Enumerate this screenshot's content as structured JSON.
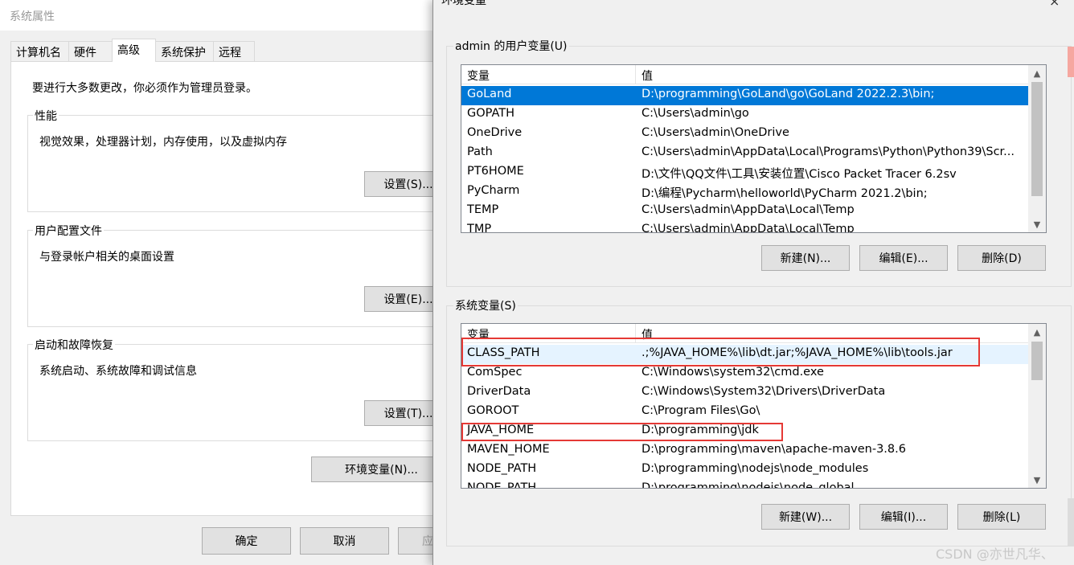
{
  "system_properties": {
    "title": "系统属性",
    "tabs": [
      "计算机名",
      "硬件",
      "高级",
      "系统保护",
      "远程"
    ],
    "active_tab": "高级",
    "admin_note": "要进行大多数更改，你必须作为管理员登录。",
    "performance": {
      "label": "性能",
      "description": "视觉效果，处理器计划，内存使用，以及虚拟内存",
      "button": "设置(S)..."
    },
    "user_profiles": {
      "label": "用户配置文件",
      "description": "与登录帐户相关的桌面设置",
      "button": "设置(E)..."
    },
    "startup_recovery": {
      "label": "启动和故障恢复",
      "description": "系统启动、系统故障和调试信息",
      "button": "设置(T)..."
    },
    "env_button": "环境变量(N)...",
    "ok_button": "确定",
    "cancel_button": "取消",
    "apply_button_partial": "应"
  },
  "env_vars": {
    "title": "环境变量",
    "close_icon": "×",
    "user_section": {
      "label": "admin 的用户变量(U)",
      "col_name": "变量",
      "col_value": "值",
      "rows": [
        {
          "name": "GoLand",
          "value": "D:\\programming\\GoLand\\go\\GoLand 2022.2.3\\bin;"
        },
        {
          "name": "GOPATH",
          "value": "C:\\Users\\admin\\go"
        },
        {
          "name": "OneDrive",
          "value": "C:\\Users\\admin\\OneDrive"
        },
        {
          "name": "Path",
          "value": "C:\\Users\\admin\\AppData\\Local\\Programs\\Python\\Python39\\Scr..."
        },
        {
          "name": "PT6HOME",
          "value": "D:\\文件\\QQ文件\\工具\\安装位置\\Cisco Packet Tracer 6.2sv"
        },
        {
          "name": "PyCharm",
          "value": "D:\\编程\\Pycharm\\helloworld\\PyCharm 2021.2\\bin;"
        },
        {
          "name": "TEMP",
          "value": "C:\\Users\\admin\\AppData\\Local\\Temp"
        },
        {
          "name": "TMP",
          "value": "C:\\Users\\admin\\AppData\\Local\\Temp"
        }
      ],
      "selected_row": "GoLand",
      "new_button": "新建(N)...",
      "edit_button": "编辑(E)...",
      "delete_button": "删除(D)"
    },
    "system_section": {
      "label": "系统变量(S)",
      "col_name": "变量",
      "col_value": "值",
      "rows": [
        {
          "name": "CLASS_PATH",
          "value": ".;%JAVA_HOME%\\lib\\dt.jar;%JAVA_HOME%\\lib\\tools.jar"
        },
        {
          "name": "ComSpec",
          "value": "C:\\Windows\\system32\\cmd.exe"
        },
        {
          "name": "DriverData",
          "value": "C:\\Windows\\System32\\Drivers\\DriverData"
        },
        {
          "name": "GOROOT",
          "value": "C:\\Program Files\\Go\\"
        },
        {
          "name": "JAVA_HOME",
          "value": "D:\\programming\\jdk"
        },
        {
          "name": "MAVEN_HOME",
          "value": "D:\\programming\\maven\\apache-maven-3.8.6"
        },
        {
          "name": "NODE_PATH",
          "value": "D:\\programming\\nodejs\\node_modules"
        },
        {
          "name": "NODE_PATH",
          "value": "D:\\programming\\nodejs\\node_global"
        }
      ],
      "highlighted_rows": [
        "CLASS_PATH",
        "JAVA_HOME"
      ],
      "new_button": "新建(W)...",
      "edit_button": "编辑(I)...",
      "delete_button": "删除(L)"
    }
  },
  "watermark": "CSDN @亦世凡华、",
  "colors": {
    "selection": "#0078d7",
    "highlight_box": "#e53935",
    "dialog_bg": "#f0f0f0"
  }
}
